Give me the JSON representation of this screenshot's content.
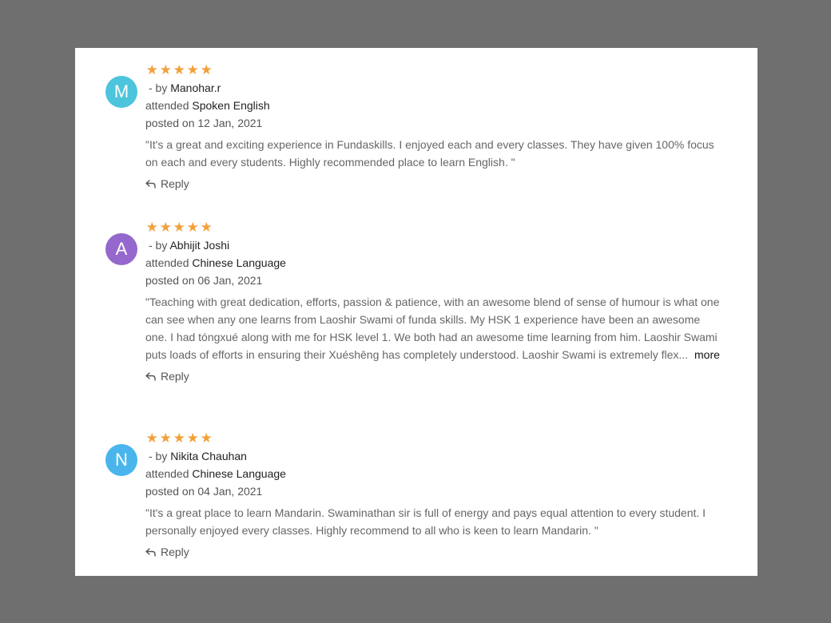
{
  "theme": {
    "star_color": "#f2a03a"
  },
  "reviews": [
    {
      "avatar_letter": "M",
      "avatar_color": "#4cc4dc",
      "rating": 5,
      "stars": "★★★★★",
      "by_prefix": "- by",
      "author": "Manohar.r",
      "attended_prefix": "attended",
      "course": "Spoken English",
      "posted": "posted on 12 Jan, 2021",
      "text": "\"It's a great and exciting experience in Fundaskills. I enjoyed each and every classes. They have given 100% focus on each and every students. Highly recommended place to learn English. \"",
      "more_label": "",
      "reply_label": "Reply"
    },
    {
      "avatar_letter": "A",
      "avatar_color": "#9468cc",
      "rating": 5,
      "stars": "★★★★★",
      "by_prefix": "- by",
      "author": "Abhijit Joshi",
      "attended_prefix": "attended",
      "course": "Chinese Language",
      "posted": "posted on 06 Jan, 2021",
      "text": "\"Teaching with great dedication, efforts, passion & patience, with an awesome blend of sense of humour is what one can see when any one learns from Laoshir Swami of funda skills. My HSK 1 experience have been an awesome one. I had tóngxué along with me for HSK level 1. We both had an awesome time learning from him. Laoshir Swami puts loads of efforts in ensuring their Xuéshēng has completely understood. Laoshir Swami is extremely flex...",
      "more_label": "more",
      "reply_label": "Reply"
    },
    {
      "avatar_letter": "N",
      "avatar_color": "#49b5ec",
      "rating": 5,
      "stars": "★★★★★",
      "by_prefix": "- by",
      "author": "Nikita Chauhan",
      "attended_prefix": "attended",
      "course": "Chinese Language",
      "posted": "posted on 04 Jan, 2021",
      "text": "\"It's a great place to learn Mandarin. Swaminathan sir is full of energy and pays equal attention to every student. I personally enjoyed every classes. Highly recommend to all who is keen to learn Mandarin. \"",
      "more_label": "",
      "reply_label": "Reply"
    }
  ]
}
